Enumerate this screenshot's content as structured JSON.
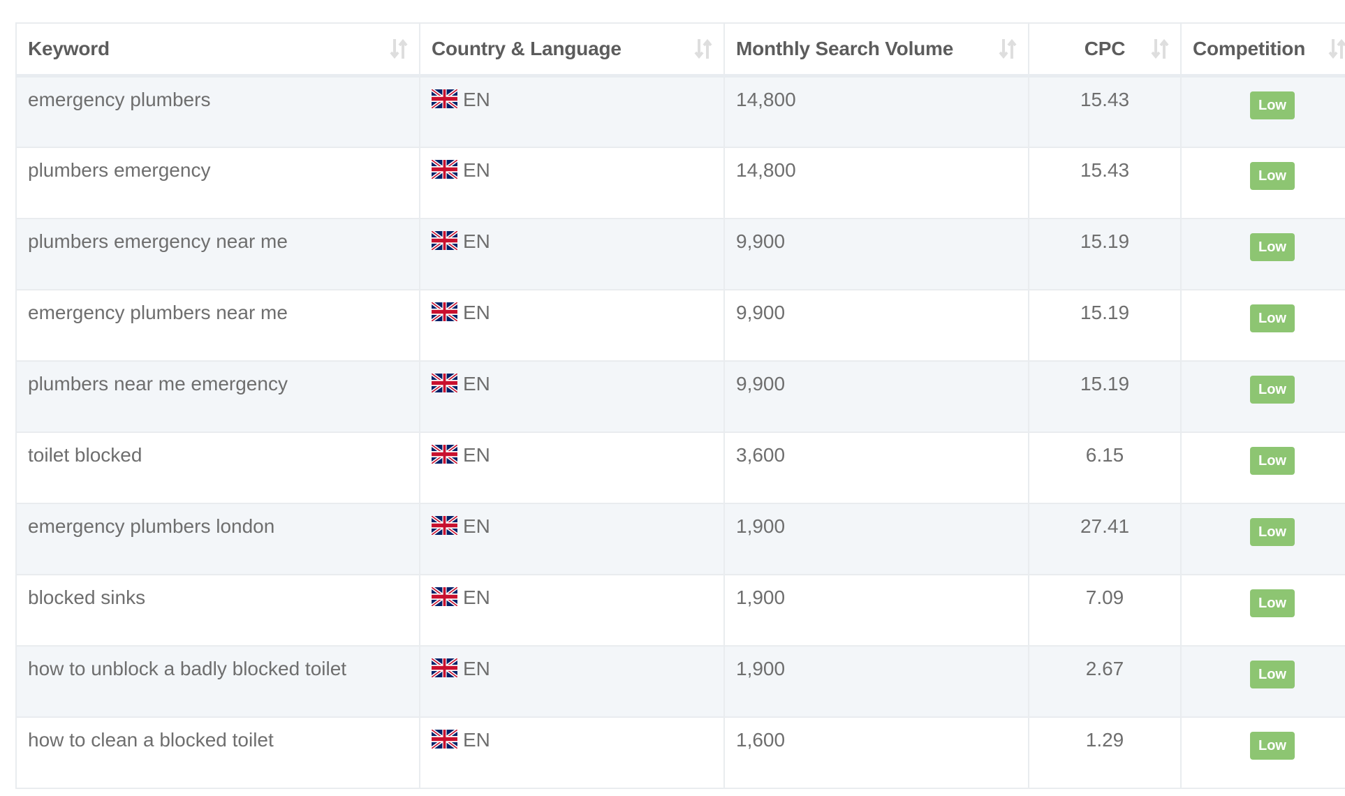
{
  "table": {
    "columns": [
      {
        "label": "Keyword",
        "sort_icon": "sort-arrows-icon"
      },
      {
        "label": "Country & Language",
        "sort_icon": "sort-arrows-icon"
      },
      {
        "label": "Monthly Search Volume",
        "sort_icon": "sort-arrows-icon"
      },
      {
        "label": "CPC",
        "sort_icon": "sort-arrows-icon"
      },
      {
        "label": "Competition",
        "sort_icon": "sort-arrows-icon"
      }
    ],
    "rows": [
      {
        "keyword": "emergency plumbers",
        "flag": "uk-flag-icon",
        "language": "EN",
        "volume": "14,800",
        "cpc": "15.43",
        "competition": "Low"
      },
      {
        "keyword": "plumbers emergency",
        "flag": "uk-flag-icon",
        "language": "EN",
        "volume": "14,800",
        "cpc": "15.43",
        "competition": "Low"
      },
      {
        "keyword": "plumbers emergency near me",
        "flag": "uk-flag-icon",
        "language": "EN",
        "volume": "9,900",
        "cpc": "15.19",
        "competition": "Low"
      },
      {
        "keyword": "emergency plumbers near me",
        "flag": "uk-flag-icon",
        "language": "EN",
        "volume": "9,900",
        "cpc": "15.19",
        "competition": "Low"
      },
      {
        "keyword": "plumbers near me emergency",
        "flag": "uk-flag-icon",
        "language": "EN",
        "volume": "9,900",
        "cpc": "15.19",
        "competition": "Low"
      },
      {
        "keyword": "toilet blocked",
        "flag": "uk-flag-icon",
        "language": "EN",
        "volume": "3,600",
        "cpc": "6.15",
        "competition": "Low"
      },
      {
        "keyword": "emergency plumbers london",
        "flag": "uk-flag-icon",
        "language": "EN",
        "volume": "1,900",
        "cpc": "27.41",
        "competition": "Low"
      },
      {
        "keyword": "blocked sinks",
        "flag": "uk-flag-icon",
        "language": "EN",
        "volume": "1,900",
        "cpc": "7.09",
        "competition": "Low"
      },
      {
        "keyword": "how to unblock a badly blocked toilet",
        "flag": "uk-flag-icon",
        "language": "EN",
        "volume": "1,900",
        "cpc": "2.67",
        "competition": "Low"
      },
      {
        "keyword": "how to clean a blocked toilet",
        "flag": "uk-flag-icon",
        "language": "EN",
        "volume": "1,600",
        "cpc": "1.29",
        "competition": "Low"
      }
    ]
  },
  "colors": {
    "badge_low": "#8dc572",
    "row_alt_bg": "#f3f6f9",
    "border": "#e9ecef",
    "header_text": "#5c5c5c",
    "body_text": "#6e6e6e"
  }
}
